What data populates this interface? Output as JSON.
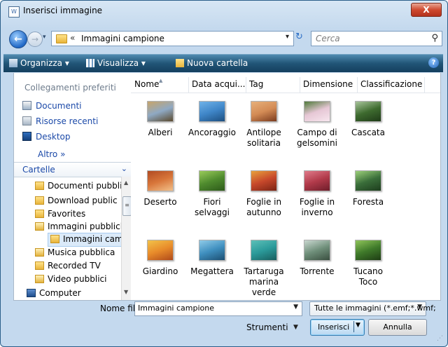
{
  "window": {
    "title": "Inserisci immagine",
    "close_label": "X"
  },
  "nav": {
    "address_separator": "«",
    "address": "Immagini campione",
    "search_placeholder": "Cerca"
  },
  "toolbar": {
    "organize": "Organizza ▾",
    "view": "Visualizza ▾",
    "new_folder": "Nuova cartella",
    "help": "?"
  },
  "sidebar": {
    "favorites_header": "Collegamenti preferiti",
    "favorites": [
      "Documenti",
      "Risorse recenti",
      "Desktop"
    ],
    "more": "Altro »",
    "folders_header": "Cartelle",
    "tree": [
      "Documenti pubbli",
      "Download public",
      "Favorites",
      "Immagini pubblicl",
      "Immagini campi",
      "Musica pubblica",
      "Recorded TV",
      "Video pubblici",
      "Computer"
    ]
  },
  "columns": [
    "Nome",
    "Data acqui...",
    "Tag",
    "Dimensione",
    "Classificazione"
  ],
  "files": [
    {
      "label": "Alberi",
      "colors": [
        "#8fa9c4",
        "#c7a46a",
        "#5b4a2e"
      ]
    },
    {
      "label": "Ancoraggio",
      "colors": [
        "#3f86c8",
        "#6fb2e8",
        "#1d4f80"
      ]
    },
    {
      "label": "Antilope\nsolitaria",
      "colors": [
        "#d38b55",
        "#e7b07a",
        "#7a3b1e"
      ]
    },
    {
      "label": "Campo di\ngelsomini",
      "colors": [
        "#e6c7d5",
        "#4f7a3a",
        "#f7e6ee"
      ]
    },
    {
      "label": "Cascata",
      "colors": [
        "#3e6b2f",
        "#a7c49a",
        "#1f3b18"
      ]
    },
    {
      "label": "Deserto",
      "colors": [
        "#d8763a",
        "#b14b22",
        "#f2c08a"
      ]
    },
    {
      "label": "Fiori selvaggi",
      "colors": [
        "#4f8b2e",
        "#9acb5a",
        "#2d5a1a"
      ]
    },
    {
      "label": "Foglie in\nautunno",
      "colors": [
        "#c7482b",
        "#e8a13c",
        "#7a2415"
      ]
    },
    {
      "label": "Foglie in\ninverno",
      "colors": [
        "#b13a4a",
        "#e07b8a",
        "#6e1d2a"
      ]
    },
    {
      "label": "Foresta",
      "colors": [
        "#3a6e3a",
        "#9cd07a",
        "#1d3d1d"
      ]
    },
    {
      "label": "Giardino",
      "colors": [
        "#e88b2a",
        "#f2c24a",
        "#b04a1a"
      ]
    },
    {
      "label": "Megattera",
      "colors": [
        "#3f8fbf",
        "#8fcbe8",
        "#1c4f72"
      ]
    },
    {
      "label": "Tartaruga\nmarina verde",
      "colors": [
        "#2b9a9a",
        "#5dc0b8",
        "#185e5e"
      ]
    },
    {
      "label": "Torrente",
      "colors": [
        "#6f8f7a",
        "#c8d7cf",
        "#3a4f40"
      ]
    },
    {
      "label": "Tucano Toco",
      "colors": [
        "#3f7a2a",
        "#8fc45a",
        "#1e3d14"
      ]
    }
  ],
  "bottom": {
    "filename_label": "Nome file:",
    "filename_value": "Immagini campione",
    "filetype_value": "Tutte le immagini (*.emf;*.wmf;",
    "tools_label": "Strumenti",
    "insert_label": "Inserisci",
    "cancel_label": "Annulla"
  }
}
